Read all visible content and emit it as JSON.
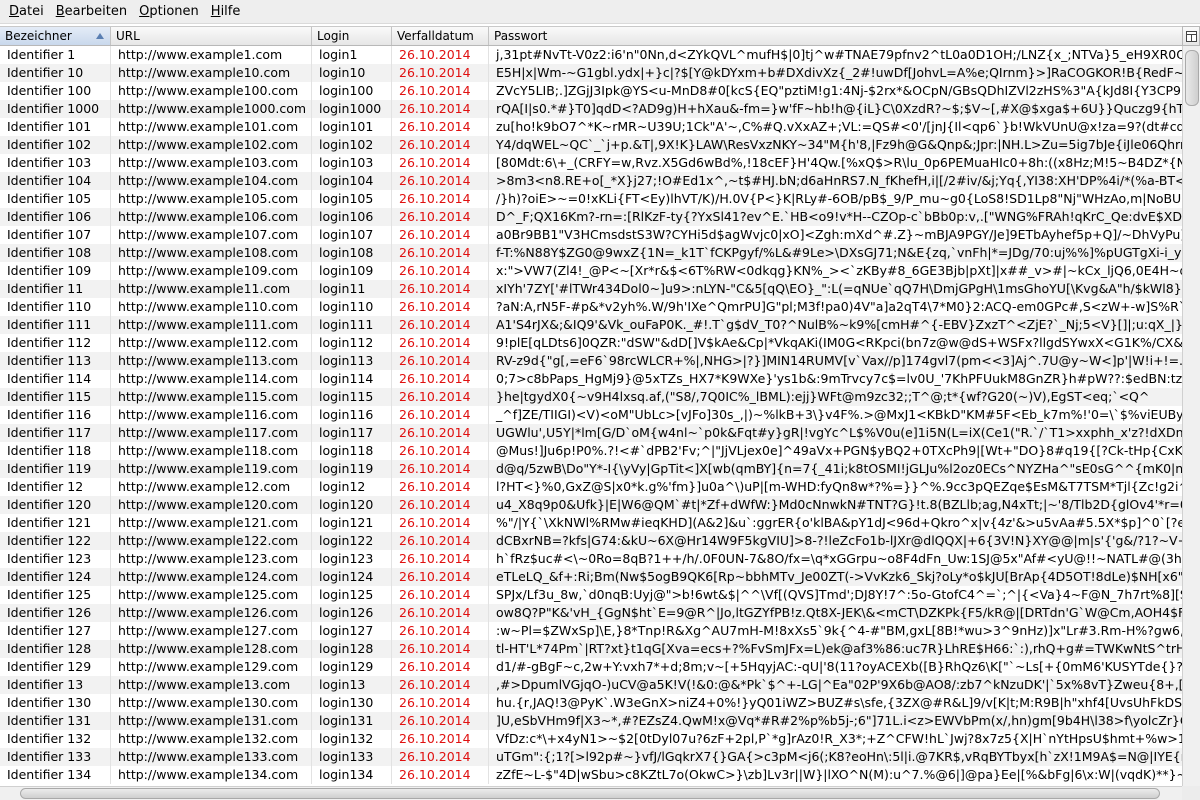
{
  "menu": [
    "Datei",
    "Bearbeiten",
    "Optionen",
    "Hilfe"
  ],
  "columns": [
    "Bezeichner",
    "URL",
    "Login",
    "Verfalldatum",
    "Passwort"
  ],
  "sorted_column": "Bezeichner",
  "date_color": "#e01010",
  "corner_icon": "column-chooser-icon",
  "rows": [
    [
      "Identifier 1",
      "http://www.example1.com",
      "login1",
      "26.10.2014",
      "j,31pt#NvTt-V0z2:i6'n\"0Nn,d<ZYkQVL^mufH$|0]tj^w#TNAE79pfnv2^tL0a0D1OH;/LNZ{x_;NTVa}5_eH9XR0Q6'2z"
    ],
    [
      "Identifier 10",
      "http://www.example10.com",
      "login10",
      "26.10.2014",
      "E5H|x|Wm-~G1gbl.ydx|+}c|?$[Y@kDYxm+b#DXdivXz{_2#!uwDf[JohvL=A%e;QIrnm}>]RaCOGKOR!B{RedF~283o"
    ],
    [
      "Identifier 100",
      "http://www.example100.com",
      "login100",
      "26.10.2014",
      "ZVcY5LIB;.]ZGjJ3Ipk@YS<u-MnD8#0[kcS{EQ\"pztiM!g1:4Nj-$2rx*&OCpN/GBsQDhIZVl2zHS%3\"A{kJd8I{Y3CP9UQe"
    ],
    [
      "Identifier 1000",
      "http://www.example1000.com",
      "login1000",
      "26.10.2014",
      "rQA[I|s0.*#}T0]qdD<?AD9g)H+hXau&-fm=}w'fF~hb!h@{iL}C\\0XzdR?~$;$V~[,#X@$xga$+6U}}Quczg9{hT>Msz"
    ],
    [
      "Identifier 101",
      "http://www.example101.com",
      "login101",
      "26.10.2014",
      "zu[ho!k9bO7^*K~rMR~U39U;1Ck\"A'~,C%#Q.vXxAZ+;VL:=QS#<0'/[jnJ{Il<qp6`}b!WkVUnU@x!za=9?(dt#cq`fAe7"
    ],
    [
      "Identifier 102",
      "http://www.example102.com",
      "login102",
      "26.10.2014",
      "Y4/dqWEL~QC`_`j+p.&T|,9X!K}LAW\\ResVxzNKY~34\"M{h'8,|Fz9h@G&Qnp&;Jpr:|NH.L>Zu=5ig7bJe{iJle06Qhrr\\~Oh"
    ],
    [
      "Identifier 103",
      "http://www.example103.com",
      "login103",
      "26.10.2014",
      "[80Mdt:6\\+_(CRFY=w,Rvz.X5Gd6wBd%,!18cEF}H'4Qw.[%xQ$>R\\lu_0p6PEMuaHIc0+8h:((x8Hz;M!5~B4DZ*{NHe9"
    ],
    [
      "Identifier 104",
      "http://www.example104.com",
      "login104",
      "26.10.2014",
      ">8m3<n8.RE+o[_*X}j27;!O#Ed1x^,~t$#HJ.bN;d6aHnRS7.N_fKhefH,i|[/2#iv/&j;Yq{,YI38:XH'DP%4i/*(%a-BT<M7U"
    ],
    [
      "Identifier 105",
      "http://www.example105.com",
      "login105",
      "26.10.2014",
      "/}h)?oiE>~=0!xKLi{FT<Ey)lhVT/K)/H.0V{P<}K|RLy#-6OB/pB$_9/P_mu~g0{LoS8!SD1Lp8\"Nj\"WHzAo,m|NoBUn2jXS"
    ],
    [
      "Identifier 106",
      "http://www.example106.com",
      "login106",
      "26.10.2014",
      "D^_F;QX16Km?-rn=:[RlKzF-ty{?YxSl41?ev^E.`HB<o9!v*H--CZOp-c`bBb0p:v,.[\"WNG%FRAh!qKrC_Qe:dvE$XD^dn<"
    ],
    [
      "Identifier 107",
      "http://www.example107.com",
      "login107",
      "26.10.2014",
      "a0Br9BB1\"V3HCmsdstS3W?CYHi5d$agWvjc0|xO]<Zgh:mXd^#.Z}~mBJA9PGY/Je]9ETbAyhef5p+Q]/~DhVyPu]}T"
    ],
    [
      "Identifier 108",
      "http://www.example108.com",
      "login108",
      "26.10.2014",
      "f-T:%N88Y$ZG0@9wxZ{1N=_k1T`fCKPgyf/%L&#9Le>\\DXsGJ71;N&E{zq,`vnFh|*=JDg/70:uj%%]%pUGTgXi-i_y3v2"
    ],
    [
      "Identifier 109",
      "http://www.example109.com",
      "login109",
      "26.10.2014",
      "x:\">VW7(Zl4!_@P<~[Xr*r&$<6T%RW<0dkqg}KN%_><`zKBy#8_6GE3Bjb|pXt]|x##_v>#|~kCx_ljQ6,0E4H~d<bLN"
    ],
    [
      "Identifier 11",
      "http://www.example11.com",
      "login11",
      "26.10.2014",
      "xIYh'7ZY['#lTWr434Dol0~]u9>:nLYN-\"C&5[qQ\\EO}_\":L(=qNUe`qQ7H\\DmjGPgH\\1msGhoYU[\\Kvg&A\"h/$kWl8}g9"
    ],
    [
      "Identifier 110",
      "http://www.example110.com",
      "login110",
      "26.10.2014",
      "?aN:A,rN5F-#p&*v2yh%.W/9h'IXe^QmrPU]G\"pl;M3f!pa0)4V\"a]a2qT4\\7*M0}2:ACQ-em0GPc#,S<zW+-w]S%R`RH.6"
    ],
    [
      "Identifier 111",
      "http://www.example111.com",
      "login111",
      "26.10.2014",
      "A1'S4rJX&;&IQ9'&Vk_ouFaP0K._#!.T`g$dV_T0?^NulB%~k9%[cmH#^{-EBV}ZxzT^<ZjE?`_Nj;5<V}[]|;u:qX_|}1}+"
    ],
    [
      "Identifier 112",
      "http://www.example112.com",
      "login112",
      "26.10.2014",
      "9!plE[qLDts6]0QZR:\"dSW\"&dD[]V$kAe&Cp|*VkqAKi(IM0G<RKpci(bn7z@w@dS+WSFx?llgdSYwxX<G1K%/CX&i5|sk"
    ],
    [
      "Identifier 113",
      "http://www.example113.com",
      "login113",
      "26.10.2014",
      "RV-z9d{\"g[,=eF6`98rcWLCR+%|,NHG>|?}]MIN14RUMV[v`Vax//p]174gvl7(pm<<3]Aj^.7U@y~W<]p'|W!i+!=.0AWI"
    ],
    [
      "Identifier 114",
      "http://www.example114.com",
      "login114",
      "26.10.2014",
      "0;7>c8bPaps_HgMj9}@5xTZs_HX7*K9WXe}'ys1b&:9mTrvcy7c$=lv0U_'7KhPFUukM8GnZR}h#pW??:$edBN:tzYLjLJ"
    ],
    [
      "Identifier 115",
      "http://www.example115.com",
      "login115",
      "26.10.2014",
      "}he|tgydX0{~v9H4lxsq.af,(\"S8/,7Q0IC%_lBML):ejj}WFt@m9zc32;;T^@;t*{wf?G20(~)V),EgST<eq;`<Q^"
    ],
    [
      "Identifier 116",
      "http://www.example116.com",
      "login116",
      "26.10.2014",
      "_^f]ZE/TIIGI)<V)<oM\"UbLc>[vJFo]30s_,|)~%lkB+3\\}v4F%.>@MxJ1<KBkD\"KM#5F<Eb_k7m%!'0=\\`$%viEUBy`N&2"
    ],
    [
      "Identifier 117",
      "http://www.example117.com",
      "login117",
      "26.10.2014",
      "UGWlu',U5Y|*lm[G/D`oM{w4nl~`p0k&Fqt#y}gR|!vgYc^L$%V0u(e]1i5N(L=iX(Ce1(\"R.`/`T1>xxphh_x'z?!dXDn_esYN"
    ],
    [
      "Identifier 118",
      "http://www.example118.com",
      "login118",
      "26.10.2014",
      "@Mus!]Ju6p!P0%.?!<#`dPB2'Fv;^|\"JjVLjex0e]^49aVx+PGN$yBQ2+0TXcPh9|[Wt+\"DO}8#q19{[?Ck-tHp{CxKjFw37,"
    ],
    [
      "Identifier 119",
      "http://www.example119.com",
      "login119",
      "26.10.2014",
      "d@q/5zwB\\Do\"Y*-I{\\yVy|GpTit<]X[wb(qmBY]{n=7{_41i;k8tOSMI!jGLJu%l2oz0ECs^NYZHa^\"sE0sG^^{mK0|naXU0"
    ],
    [
      "Identifier 12",
      "http://www.example12.com",
      "login12",
      "26.10.2014",
      "l?HT<}%0,GxZ@S|x0*k.g%'fm}]u0a^\\)uP|[m-WHD:fyQn8w*?%=}}^%.9cc3pQEZqe$EsM&T7TSM*Tjl{Zc!g2i^<*"
    ],
    [
      "Identifier 120",
      "http://www.example120.com",
      "login120",
      "26.10.2014",
      "u4_X8q9p0&Ufk}|E|W6@QM`#t|*Zf+dWfW:}Md0cNnwkN#TNT?G}!t.8(BZLlb;ag,N4xTt;|~'8/Tlb2D{glOv4'*r=0XrRM"
    ],
    [
      "Identifier 121",
      "http://www.example121.com",
      "login121",
      "26.10.2014",
      "%\"/|Y{`\\XkNWl%RMw#ieqKHD](A&2]&u`:ggrER{o'klBA&pY1dJ<96d+Qkro^x|v{4z'&>u5vAa#5.5X*$p]^0`[?e;x6"
    ],
    [
      "Identifier 122",
      "http://www.example122.com",
      "login122",
      "26.10.2014",
      "dCBxrNB=?kfs|G74:&kU~6X@Hr14W9F5kgVIU]>8-?!leZcFo1b-lJXr@dlQQX|+6{3V!N}XY@@|m|s'{'g&/?1?~V+*Hk"
    ],
    [
      "Identifier 123",
      "http://www.example123.com",
      "login123",
      "26.10.2014",
      "h`fRz$uc#<\\~0Ro=8qB?1++/h/.0F0UN-7&8O/fx=\\q*xGGrpu~o8F4dFn_Uw:1SJ@5x\"Af#<yU@!!~NATL#@(3h6)[E"
    ],
    [
      "Identifier 124",
      "http://www.example124.com",
      "login124",
      "26.10.2014",
      "eTLeLQ_&f+:Ri;Bm(Nw$5ogB9QK6[Rp~bbhMTv_Je00ZT(->VvKzk6_Skj?oLy*o$kJU[BrAp{4D5OT!8dLe)$NH[x6\"_gk/"
    ],
    [
      "Identifier 125",
      "http://www.example125.com",
      "login125",
      "26.10.2014",
      "SPJx/Lf3u_8w,`d0nqB:Uyj@\">b!6wt&$|^^\\Vf[(QVS]Tmd';DJ8Y!7^:5o-GtofC4^=`;^|{<Va}4~F@N_7h7rt%8][S(3V3"
    ],
    [
      "Identifier 126",
      "http://www.example126.com",
      "login126",
      "26.10.2014",
      "ow8Q?P\"K&'vH_{GgN$ht`E=9@R^|Jo,ltGZYfPB!z.Qt8X-JEK\\&<mCT\\DZKPk{F5/kR@|[DRTdn'G`W@Cm,AOH4$FGc]fn"
    ],
    [
      "Identifier 127",
      "http://www.example127.com",
      "login127",
      "26.10.2014",
      ":w~Pl=$ZWxSp]\\E,}8*Tnp!R&Xg^AU7mH-M!8xXs5`9k{^4-#\"BM,gxL[8B!*wu>3^9nHz)]x\"Lr#3.Rm-H%?gw6,',}H+"
    ],
    [
      "Identifier 128",
      "http://www.example128.com",
      "login128",
      "26.10.2014",
      "tl-HT'L*74Pm`|RT?xt}t1qG[Xva=ecs+?%FvSmJFx=L)ek@af3%86:uc7R}LhRE$H66:`:),rhQ+g#=TWKwNtS^trHKZF~"
    ],
    [
      "Identifier 129",
      "http://www.example129.com",
      "login129",
      "26.10.2014",
      "d1/#-gBgF~c,2w+Y:vxh7*+d;8m;v~[+5HqyjAC:-qU|'8(11?oyACEXb([B}RhQz6\\K[\"`~Ls[+{0mM6'KUSYTde{}?r7x2H"
    ],
    [
      "Identifier 13",
      "http://www.example13.com",
      "login13",
      "26.10.2014",
      ",#>DpumlVGjqO-)uCV@a5K!V(!&0:@&*Pk`$^+-LG|^Ea\"02P'9X6b@AO8/:zb7^kNzuDK'|`5x%8vT}Zweu{8+,[wta-"
    ],
    [
      "Identifier 130",
      "http://www.example130.com",
      "login130",
      "26.10.2014",
      "hu.{r,JAQ!3@PyK`.W3eGnX>niZ4+0%!}yQ01iWZ>BUZ#s\\sfe,{3ZX@#R&L]9/v[K|t;M:R9B|h\"xhf4[UvsUhFkDSS:(v"
    ],
    [
      "Identifier 131",
      "http://www.example131.com",
      "login131",
      "26.10.2014",
      "]U,eSbVHm9f|X3~*,#?EZsZ4.QwM!x@Vq*#R#2%p%b5j-;6\"]71L.i<z>EWVbPm(x/,hn)gm[9b4H\\l38>f\\yolcZr}Qdo8"
    ],
    [
      "Identifier 132",
      "http://www.example132.com",
      "login132",
      "26.10.2014",
      "VfDz:c*\\+x4yN1>~$2[0tDyl07u?6zF+2pl,P`*g]rAz0!R_X3*;+Z^CFW!hL`Jwj?8x7z5{X|H`nYtHpsU$hmt+%w>1ePYjb"
    ],
    [
      "Identifier 133",
      "http://www.example133.com",
      "login133",
      "26.10.2014",
      "uTGm\":{;1?[>l92p#~}vfJ/lGqkrX7{}GA{>c3pM<j6(;K8?eoHn\\:5l|i.@7KR$,vRqBYTbyx[h`zX!1M9A$=N@|IYE{mSV|k5"
    ],
    [
      "Identifier 134",
      "http://www.example134.com",
      "login134",
      "26.10.2014",
      "zZfE~L-$\"4D|wSbu>c8KZtL7o(OkwC>}\\zb]Lv3r||W}|lXO^N(M):u^7.%@6|]@pa}Ee|[%&bFg|6\\x:W|(vqdK)**}~t6?!"
    ]
  ]
}
